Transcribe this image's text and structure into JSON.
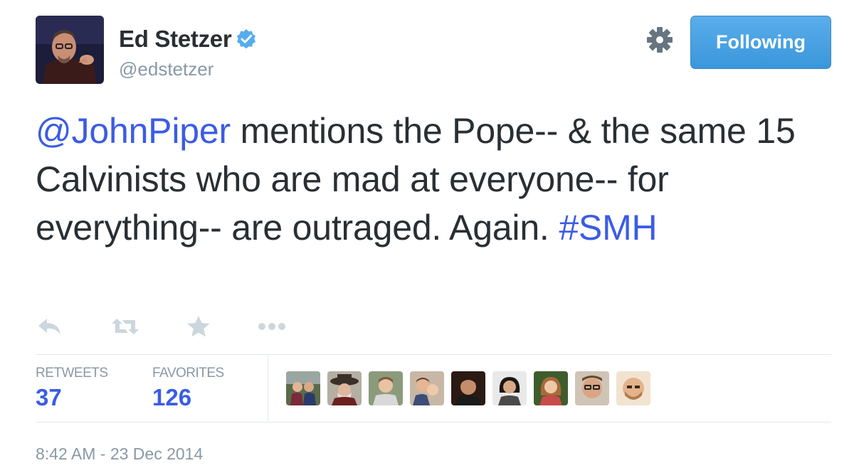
{
  "header": {
    "name": "Ed Stetzer",
    "handle": "@edstetzer",
    "follow_label": "Following"
  },
  "tweet": {
    "mention": "@JohnPiper",
    "text_before_hashtag": " mentions the Pope-- & the same 15 Calvinists who are mad at everyone-- for everything-- are outraged. Again. ",
    "hashtag": "#SMH"
  },
  "actions": {
    "icons": [
      "reply-icon",
      "retweet-icon",
      "favorite-icon",
      "more-icon"
    ]
  },
  "stats": {
    "retweets_label": "RETWEETS",
    "retweets_count": "37",
    "favorites_label": "FAVORITES",
    "favorites_count": "126",
    "avatar_count": 9
  },
  "footer": {
    "timestamp": "8:42 AM - 23 Dec 2014"
  },
  "colors": {
    "link": "#3b5ce4",
    "text": "#292f33",
    "muted": "#8899a6",
    "button": "#4aa1e4",
    "verified": "#55acee"
  }
}
